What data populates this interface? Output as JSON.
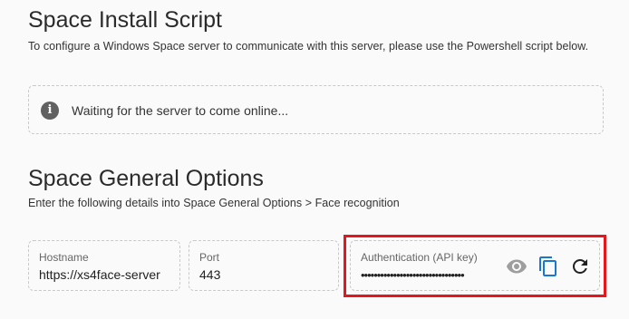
{
  "install": {
    "title": "Space Install Script",
    "description": "To configure a Windows Space server to communicate with this server, please use the Powershell script below."
  },
  "alert": {
    "icon": "info-icon",
    "text": "Waiting for the server to come online..."
  },
  "general": {
    "title": "Space General Options",
    "description": "Enter the following details into Space General Options > Face recognition"
  },
  "fields": {
    "hostname": {
      "label": "Hostname",
      "value": "https://xs4face-server"
    },
    "port": {
      "label": "Port",
      "value": "443"
    },
    "auth": {
      "label": "Authentication (API key)",
      "value": "••••••••••••••••••••••••••••••••"
    }
  },
  "icons": {
    "eye": "eye-icon",
    "copy": "copy-icon",
    "refresh": "refresh-icon"
  },
  "colors": {
    "highlight": "#e3171c",
    "accent": "#1976d2",
    "icon_gray": "#9e9e9e"
  }
}
